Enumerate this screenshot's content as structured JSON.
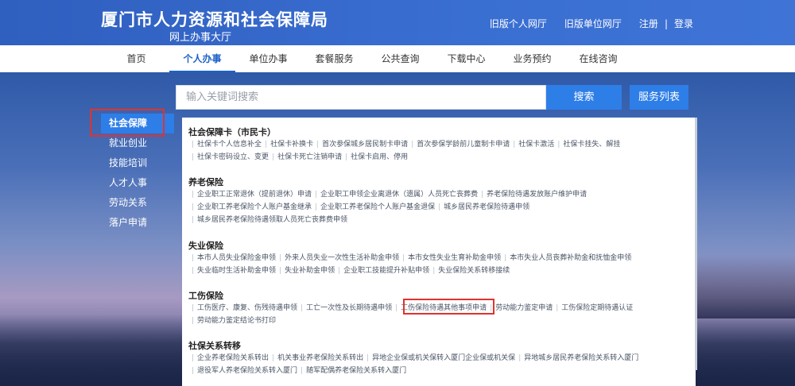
{
  "header": {
    "title": "厦门市人力资源和社会保障局",
    "subtitle": "网上办事大厅",
    "links": {
      "old_personal": "旧版个人网厅",
      "old_unit": "旧版单位网厅",
      "register": "注册",
      "separator": "|",
      "login": "登录"
    }
  },
  "nav": [
    "首页",
    "个人办事",
    "单位办事",
    "套餐服务",
    "公共查询",
    "下载中心",
    "业务预约",
    "在线咨询"
  ],
  "search": {
    "placeholder": "输入关键词搜索",
    "search_label": "搜索",
    "service_list_label": "服务列表"
  },
  "sidebar": [
    "社会保障",
    "就业创业",
    "技能培训",
    "人才人事",
    "劳动关系",
    "落户申请"
  ],
  "sections": [
    {
      "title": "社会保障卡（市民卡）",
      "rows": [
        [
          "社保卡个人信息补全",
          "社保卡补换卡",
          "首次参保城乡居民制卡申请",
          "首次参保学龄前儿童制卡申请",
          "社保卡激活",
          "社保卡挂失、解挂"
        ],
        [
          "社保卡密码设立、变更",
          "社保卡死亡注销申请",
          "社保卡启用、停用"
        ]
      ]
    },
    {
      "title": "养老保险",
      "rows": [
        [
          "企业职工正常退休（提前退休）申请",
          "企业职工申领企业离退休（遗属）人员死亡丧葬费",
          "养老保险待遇发放账户维护申请"
        ],
        [
          "企业职工养老保险个人账户基金继承",
          "企业职工养老保险个人账户基金退保",
          "城乡居民养老保险待遇申领"
        ],
        [
          "城乡居民养老保险待遇领取人员死亡丧葬费申领"
        ]
      ]
    },
    {
      "title": "失业保险",
      "rows": [
        [
          "本市人员失业保险金申领",
          "外来人员失业一次性生活补助金申领",
          "本市女性失业生育补助金申领",
          "本市失业人员丧葬补助金和抚恤金申领"
        ],
        [
          "失业临时生活补助金申领",
          "失业补助金申领",
          "企业职工技能提升补贴申领",
          "失业保险关系转移接续"
        ]
      ]
    },
    {
      "title": "工伤保险",
      "rows": [
        [
          "工伤医疗、康复、伤残待遇申领",
          "工亡一次性及长期待遇申领",
          "工伤保险待遇其他事项申请",
          "劳动能力鉴定申请",
          "工伤保险定期待遇认证"
        ],
        [
          "劳动能力鉴定结论书打印"
        ]
      ]
    },
    {
      "title": "社保关系转移",
      "rows": [
        [
          "企业养老保险关系转出",
          "机关事业养老保险关系转出",
          "异地企业保或机关保转入厦门企业保或机关保",
          "异地城乡居民养老保险关系转入厦门"
        ],
        [
          "退役军人养老保险关系转入厦门",
          "随军配偶养老保险关系转入厦门"
        ]
      ]
    }
  ]
}
